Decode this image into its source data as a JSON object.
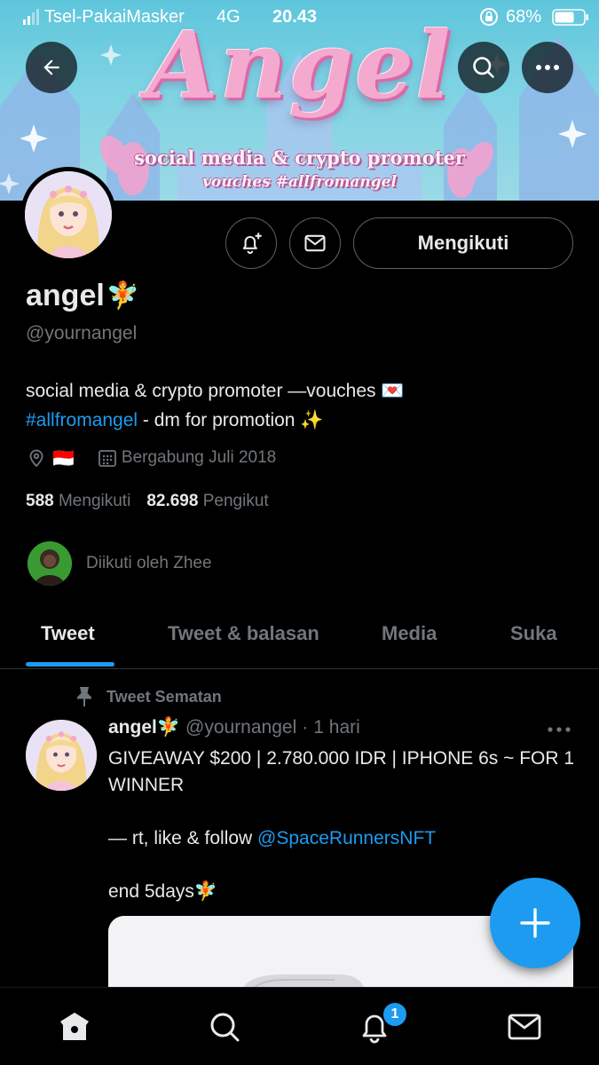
{
  "status_bar": {
    "carrier": "Tsel-PakaiMasker",
    "network": "4G",
    "time": "20.43",
    "battery": "68%"
  },
  "banner": {
    "title": "Angel",
    "subtitle": "social media & crypto promoter",
    "subtitle2": "vouches #allfromangel"
  },
  "header": {
    "back_icon": "arrow-left-icon",
    "search_icon": "search-icon",
    "more_icon": "more-horizontal-icon"
  },
  "profile": {
    "display_name": "angel",
    "name_emoji": "🧚",
    "handle": "@yournangel",
    "bio_line1": "social media & crypto promoter —vouches 💌",
    "bio_hashtag": "#allfromangel",
    "bio_rest": " - dm for promotion ✨",
    "location_flag": "🇮🇩",
    "joined": "Bergabung Juli 2018",
    "following_count": "588",
    "following_label": "Mengikuti",
    "followers_count": "82.698",
    "followers_label": "Pengikut",
    "followed_by": "Diikuti oleh Zhee"
  },
  "actions": {
    "follow_label": "Mengikuti"
  },
  "tabs": [
    {
      "label": "Tweet",
      "active": true
    },
    {
      "label": "Tweet & balasan",
      "active": false
    },
    {
      "label": "Media",
      "active": false
    },
    {
      "label": "Suka",
      "active": false
    }
  ],
  "pinned_tweet": {
    "pinned_label": "Tweet Sematan",
    "author": "angel",
    "author_emoji": "🧚",
    "handle": "@yournangel",
    "separator": "·",
    "time": "1 hari",
    "line1": "GIVEAWAY $200 | 2.780.000 IDR | IPHONE 6s ~ FOR 1 WINNER",
    "line2_prefix": "— rt, like & follow ",
    "line2_mention": "@SpaceRunnersNFT",
    "line3": "end 5days🧚"
  },
  "bottom_nav": {
    "notification_count": "1"
  },
  "colors": {
    "accent": "#1d9bf0",
    "background": "#000000",
    "text": "#e7e9ea",
    "muted": "#71767b"
  }
}
